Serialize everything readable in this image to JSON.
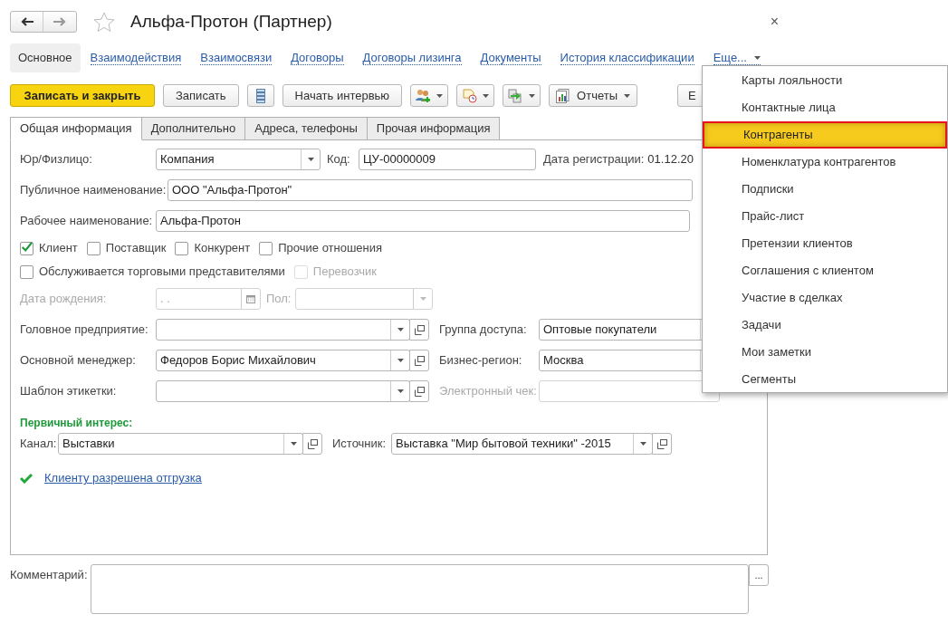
{
  "window": {
    "title": "Альфа-Протон (Партнер)",
    "favorite": false,
    "close": "×"
  },
  "nav": [
    {
      "label": "Основное",
      "selected": true,
      "kind": "link"
    },
    {
      "label": "Взаимодействия",
      "selected": false,
      "kind": "link"
    },
    {
      "label": "Взаимосвязи",
      "selected": false,
      "kind": "link"
    },
    {
      "label": "Договоры",
      "selected": false,
      "kind": "link"
    },
    {
      "label": "Договоры лизинга",
      "selected": false,
      "kind": "link"
    },
    {
      "label": "Документы",
      "selected": false,
      "kind": "link"
    },
    {
      "label": "История классификации",
      "selected": false,
      "kind": "link"
    },
    {
      "label": "Еще...",
      "selected": false,
      "kind": "more"
    }
  ],
  "toolbar": [
    {
      "kind": "primary",
      "label": "Записать и закрыть"
    },
    {
      "kind": "plain",
      "label": "Записать"
    },
    {
      "kind": "list"
    },
    {
      "kind": "plain",
      "label": "Начать интервью"
    },
    {
      "kind": "people"
    },
    {
      "kind": "calendar"
    },
    {
      "kind": "copy"
    },
    {
      "kind": "reports",
      "label": "Отчеты"
    },
    {
      "kind": "cut",
      "label": "Е"
    }
  ],
  "tabs": [
    {
      "label": "Общая информация",
      "selected": true
    },
    {
      "label": "Дополнительно",
      "selected": false
    },
    {
      "label": "Адреса, телефоны",
      "selected": false
    },
    {
      "label": "Прочая информация",
      "selected": false
    }
  ],
  "form": {
    "legal_type": {
      "label": "Юр/Физлицо:",
      "value": "Компания"
    },
    "code": {
      "label": "Код:",
      "value": "ЦУ-00000009"
    },
    "reg_date": {
      "label": "Дата регистрации:",
      "value": "01.12.20"
    },
    "public_name": {
      "label": "Публичное наименование:",
      "value": "ООО \"Альфа-Протон\""
    },
    "work_name": {
      "label": "Рабочее наименование:",
      "value": "Альфа-Протон"
    },
    "relations": [
      {
        "label": "Клиент",
        "checked": true,
        "disabled": false
      },
      {
        "label": "Поставщик",
        "checked": false,
        "disabled": false
      },
      {
        "label": "Конкурент",
        "checked": false,
        "disabled": false
      },
      {
        "label": "Прочие отношения",
        "checked": false,
        "disabled": false
      }
    ],
    "service": [
      {
        "label": "Обслуживается торговыми представителями",
        "checked": false,
        "disabled": false
      },
      {
        "label": "Перевозчик",
        "checked": false,
        "disabled": true
      }
    ],
    "birth_date": {
      "label": "Дата рождения:",
      "value": ". .",
      "disabled": true
    },
    "gender": {
      "label": "Пол:",
      "disabled": true
    },
    "parent_company": {
      "label": "Головное предприятие:"
    },
    "access_group": {
      "label": "Группа доступа:",
      "value": "Оптовые покупатели"
    },
    "manager": {
      "label": "Основной менеджер:",
      "value": "Федоров Борис Михайлович"
    },
    "business_region": {
      "label": "Бизнес-регион:",
      "value": "Москва"
    },
    "label_template": {
      "label": "Шаблон этикетки:"
    },
    "e_receipt": {
      "label": "Электронный чек:",
      "disabled": true
    },
    "interest": {
      "title": "Первичный интерес:",
      "channel": {
        "label": "Канал:",
        "value": "Выставки"
      },
      "source": {
        "label": "Источник:",
        "value": "Выставка \"Мир бытовой техники\" -2015"
      }
    },
    "shipment": {
      "text": "Клиенту разрешена отгрузка",
      "allowed": true
    }
  },
  "comment": {
    "label": "Комментарий:",
    "button": "..."
  },
  "menu": {
    "items": [
      {
        "label": "Карты лояльности",
        "selected": false
      },
      {
        "label": "Контактные лица",
        "selected": false
      },
      {
        "label": "Контрагенты",
        "selected": true
      },
      {
        "label": "Номенклатура контрагентов",
        "selected": false
      },
      {
        "label": "Подписки",
        "selected": false
      },
      {
        "label": "Прайс-лист",
        "selected": false
      },
      {
        "label": "Претензии клиентов",
        "selected": false
      },
      {
        "label": "Соглашения с клиентом",
        "selected": false
      },
      {
        "label": "Участие в сделках",
        "selected": false
      },
      {
        "label": "Задачи",
        "selected": false
      },
      {
        "label": "Мои заметки",
        "selected": false
      },
      {
        "label": "Сегменты",
        "selected": false
      }
    ]
  }
}
